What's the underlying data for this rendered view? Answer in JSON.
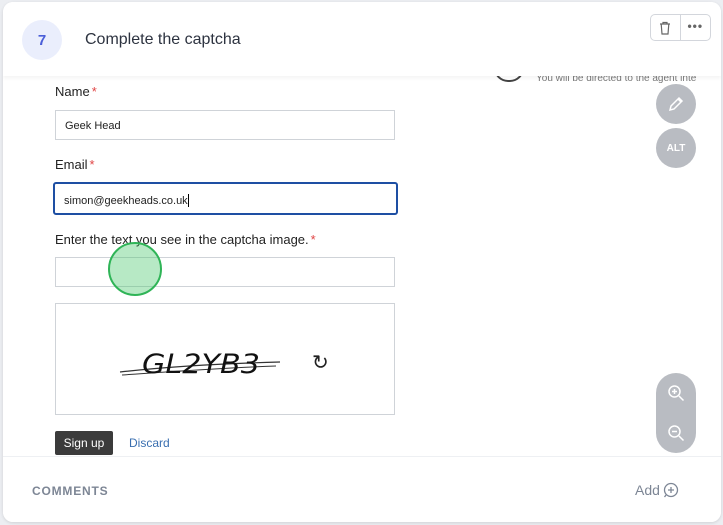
{
  "header": {
    "step_number": "7",
    "title": "Complete the captcha",
    "delete_icon": "trash-icon",
    "more_icon": "more-dots-icon"
  },
  "screenshot": {
    "partial_text": "You will be directed to the agent inte",
    "form": {
      "name_label": "Name",
      "name_value": "Geek Head",
      "email_label": "Email",
      "email_value": "simon@geekheads.co.uk",
      "captcha_label": "Enter the text you see in the captcha image.",
      "captcha_input_value": "",
      "required_mark": "*",
      "captcha_text": "GL2YB3",
      "refresh_icon": "refresh-icon",
      "signup_label": "Sign up",
      "discard_label": "Discard"
    },
    "click_marker_color": "#2fb457"
  },
  "side_tools": {
    "edit_icon": "pencil-icon",
    "alt_label": "ALT",
    "zoom_in_icon": "zoom-in-icon",
    "zoom_out_icon": "zoom-out-icon"
  },
  "footer": {
    "comments_label": "COMMENTS",
    "add_label": "Add",
    "add_icon": "add-comment-icon"
  },
  "colors": {
    "accent": "#4a5ed8",
    "active_border": "#1e4fa3",
    "required": "#e04444",
    "link": "#3a6fb0"
  }
}
